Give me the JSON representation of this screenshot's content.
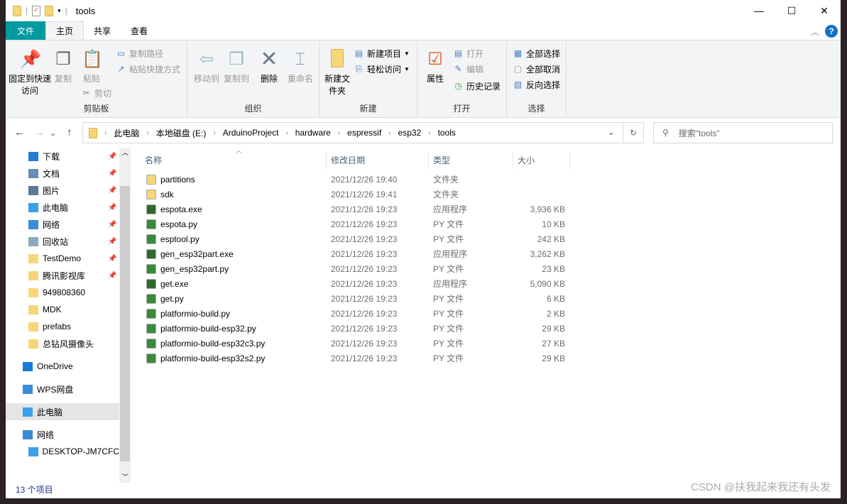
{
  "window": {
    "title": "tools",
    "controls": {
      "min": "—",
      "max": "☐",
      "close": "✕"
    }
  },
  "tabs": [
    "文件",
    "主页",
    "共享",
    "查看"
  ],
  "help": "?",
  "ribbon": {
    "clipboard": {
      "label": "剪贴板",
      "pin": "固定到快速访问",
      "copy": "复制",
      "paste": "粘贴",
      "copy_path": "复制路径",
      "paste_shortcut": "粘贴快捷方式",
      "cut": "剪切"
    },
    "organize": {
      "label": "组织",
      "move_to": "移动到",
      "copy_to": "复制到",
      "delete": "删除",
      "rename": "重命名"
    },
    "new": {
      "label": "新建",
      "new_folder": "新建文件夹",
      "new_item": "新建项目",
      "easy_access": "轻松访问"
    },
    "open": {
      "label": "打开",
      "properties": "属性",
      "open": "打开",
      "edit": "编辑",
      "history": "历史记录"
    },
    "select": {
      "label": "选择",
      "select_all": "全部选择",
      "select_none": "全部取消",
      "invert": "反向选择"
    }
  },
  "address": {
    "crumbs": [
      "此电脑",
      "本地磁盘 (E:)",
      "ArduinoProject",
      "hardware",
      "espressif",
      "esp32",
      "tools"
    ],
    "search_placeholder": "搜索\"tools\""
  },
  "sidebar": [
    {
      "label": "下载",
      "pinned": true,
      "icon": "download-icon"
    },
    {
      "label": "文档",
      "pinned": true,
      "icon": "document-icon"
    },
    {
      "label": "图片",
      "pinned": true,
      "icon": "picture-icon"
    },
    {
      "label": "此电脑",
      "pinned": true,
      "icon": "computer-icon"
    },
    {
      "label": "网络",
      "pinned": true,
      "icon": "network-icon"
    },
    {
      "label": "回收站",
      "pinned": true,
      "icon": "recycle-bin-icon"
    },
    {
      "label": "TestDemo",
      "pinned": true,
      "icon": "folder-icon"
    },
    {
      "label": "腾讯影视库",
      "pinned": true,
      "icon": "folder-icon"
    },
    {
      "label": "949808360",
      "pinned": false,
      "icon": "folder-icon"
    },
    {
      "label": "MDK",
      "pinned": false,
      "icon": "folder-icon"
    },
    {
      "label": "prefabs",
      "pinned": false,
      "icon": "folder-icon"
    },
    {
      "label": "总钻风摄像头",
      "pinned": false,
      "icon": "folder-icon"
    }
  ],
  "sidebar_roots": [
    {
      "label": "OneDrive",
      "icon": "onedrive-icon"
    },
    {
      "label": "WPS网盘",
      "icon": "cloud-icon"
    },
    {
      "label": "此电脑",
      "icon": "computer-icon",
      "selected": true
    },
    {
      "label": "网络",
      "icon": "network-icon"
    },
    {
      "label": "DESKTOP-JM7CFC",
      "icon": "computer-icon"
    }
  ],
  "columns": [
    "名称",
    "修改日期",
    "类型",
    "大小"
  ],
  "files": [
    {
      "name": "partitions",
      "date": "2021/12/26 19:40",
      "type": "文件夹",
      "size": "",
      "kind": "folder"
    },
    {
      "name": "sdk",
      "date": "2021/12/26 19:41",
      "type": "文件夹",
      "size": "",
      "kind": "folder"
    },
    {
      "name": "espota.exe",
      "date": "2021/12/26 19:23",
      "type": "应用程序",
      "size": "3,936 KB",
      "kind": "exe"
    },
    {
      "name": "espota.py",
      "date": "2021/12/26 19:23",
      "type": "PY 文件",
      "size": "10 KB",
      "kind": "py"
    },
    {
      "name": "esptool.py",
      "date": "2021/12/26 19:23",
      "type": "PY 文件",
      "size": "242 KB",
      "kind": "py"
    },
    {
      "name": "gen_esp32part.exe",
      "date": "2021/12/26 19:23",
      "type": "应用程序",
      "size": "3,262 KB",
      "kind": "exe"
    },
    {
      "name": "gen_esp32part.py",
      "date": "2021/12/26 19:23",
      "type": "PY 文件",
      "size": "23 KB",
      "kind": "py"
    },
    {
      "name": "get.exe",
      "date": "2021/12/26 19:23",
      "type": "应用程序",
      "size": "5,090 KB",
      "kind": "exe"
    },
    {
      "name": "get.py",
      "date": "2021/12/26 19:23",
      "type": "PY 文件",
      "size": "6 KB",
      "kind": "py"
    },
    {
      "name": "platformio-build.py",
      "date": "2021/12/26 19:23",
      "type": "PY 文件",
      "size": "2 KB",
      "kind": "py"
    },
    {
      "name": "platformio-build-esp32.py",
      "date": "2021/12/26 19:23",
      "type": "PY 文件",
      "size": "29 KB",
      "kind": "py"
    },
    {
      "name": "platformio-build-esp32c3.py",
      "date": "2021/12/26 19:23",
      "type": "PY 文件",
      "size": "27 KB",
      "kind": "py"
    },
    {
      "name": "platformio-build-esp32s2.py",
      "date": "2021/12/26 19:23",
      "type": "PY 文件",
      "size": "29 KB",
      "kind": "py"
    }
  ],
  "status": "13 个项目",
  "watermark": "CSDN @扶我起来我还有头发",
  "colors": {
    "file_tab": "#009aa0",
    "accent": "#1470c8"
  }
}
